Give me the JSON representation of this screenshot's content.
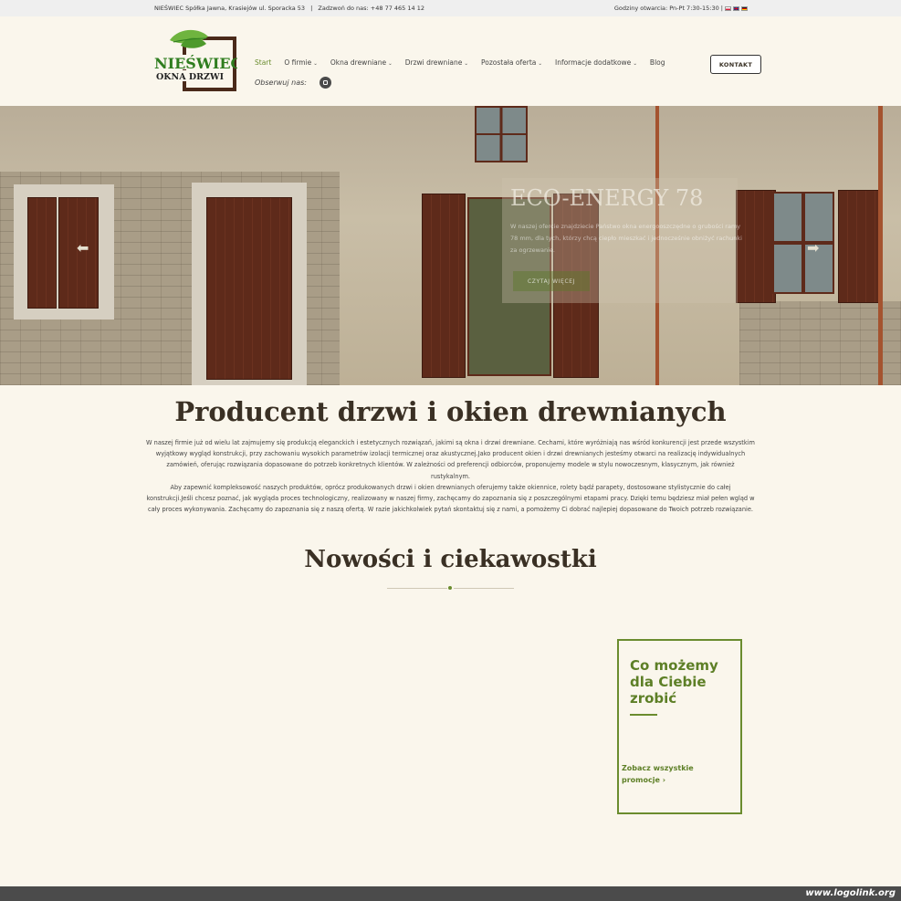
{
  "topbar": {
    "company": "NIEŚWIEC Spółka Jawna, Krasiejów ul. Sporacka 53",
    "separator": "|",
    "phone": "Zadzwoń do nas: +48 77 465 14 12",
    "hours": "Godziny otwarcia: Pn-Pt 7:30-15:30 |",
    "languages": [
      "pl-flag-icon",
      "en-flag-icon",
      "de-flag-icon"
    ]
  },
  "logo": {
    "line1": "NIEŚWIEC",
    "line2": "OKNA  DRZWI",
    "colors": {
      "green": "#2f7d1f",
      "leaf": "#6fb43f",
      "frame": "#4a2a1a"
    }
  },
  "nav": {
    "items": [
      {
        "label": "Start",
        "active": true,
        "dropdown": false
      },
      {
        "label": "O firmie",
        "active": false,
        "dropdown": true
      },
      {
        "label": "Okna drewniane",
        "active": false,
        "dropdown": true
      },
      {
        "label": "Drzwi drewniane",
        "active": false,
        "dropdown": true
      },
      {
        "label": "Pozostała oferta",
        "active": false,
        "dropdown": true
      },
      {
        "label": "Informacje dodatkowe",
        "active": false,
        "dropdown": true
      },
      {
        "label": "Blog",
        "active": false,
        "dropdown": false
      }
    ],
    "chevron": "⌄",
    "follow_label": "Obserwuj nas:",
    "contact_button": "KONTAKT"
  },
  "hero": {
    "title": "ECO-ENERGY 78",
    "text": "W naszej ofercie znajdziecie Państwo okna energooszczędne o grubości ramy 78 mm, dla tych, którzy chcą ciepło mieszkać i jednocześnie obniżyć rachunki za ogrzewanie.",
    "button": "CZYTAJ WIĘCEJ",
    "arrow_left": "⬅",
    "arrow_right": "➡"
  },
  "main": {
    "heading": "Producent drzwi i okien drewnianych",
    "paragraph1": "W naszej firmie już od wielu lat zajmujemy się produkcją eleganckich i estetycznych rozwiązań, jakimi są okna i drzwi drewniane. Cechami, które wyróżniają nas wśród konkurencji jest przede wszystkim wyjątkowy wygląd konstrukcji, przy zachowaniu wysokich parametrów izolacji termicznej oraz akustycznej.Jako producent okien i drzwi drewnianych jesteśmy otwarci na realizację indywidualnych zamówień, oferując rozwiązania dopasowane do potrzeb konkretnych klientów. W zależności od preferencji odbiorców, proponujemy modele w stylu nowoczesnym, klasycznym, jak również rustykalnym.",
    "paragraph2": "Aby zapewnić kompleksowość naszych produktów, oprócz produkowanych drzwi i okien drewnianych oferujemy także okiennice, rolety bądź parapety, dostosowane stylistycznie do całej konstrukcji.Jeśli chcesz poznać, jak wygląda proces technologiczny, realizowany w naszej firmy, zachęcamy do zapoznania się z poszczególnymi etapami pracy. Dzięki temu będziesz miał pełen wgląd w cały proces wykonywania. Zachęcamy do zapoznania się z naszą ofertą. W razie jakichkolwiek pytań skontaktuj się z nami, a pomożemy Ci dobrać najlepiej dopasowane do Twoich potrzeb rozwiązanie.",
    "news_heading": "Nowości i ciekawostki"
  },
  "promo": {
    "title": "Co możemy dla Ciebie zrobić",
    "link": "Zobacz wszystkie promocje ›",
    "accent": "#6a8c2e"
  },
  "footer": {
    "watermark": "www.logolink.org"
  }
}
